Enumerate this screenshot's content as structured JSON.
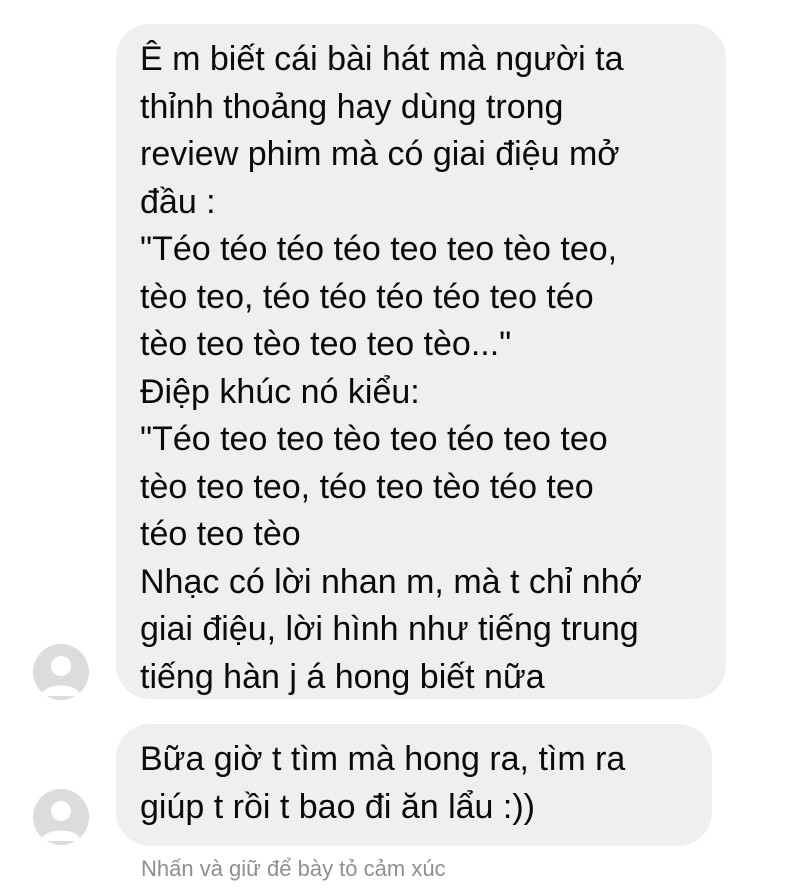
{
  "messages": [
    {
      "lines": [
        "Ê m biết cái bài hát mà người ta",
        "thỉnh thoảng hay dùng trong",
        "review phim mà có giai điệu mở",
        "đầu :",
        "\"Téo téo téo téo teo teo tèo teo,",
        "tèo teo, téo téo téo téo teo téo",
        "tèo teo tèo teo teo tèo...\"",
        "Điệp khúc nó kiểu:",
        "\"Téo teo teo tèo teo téo teo teo",
        "tèo teo teo, téo teo tèo téo teo",
        "téo teo tèo",
        "Nhạc có lời nhan m, mà t chỉ nhớ",
        "giai điệu, lời hình như tiếng trung",
        "tiếng hàn j á hong biết nữa"
      ]
    },
    {
      "lines": [
        "Bữa giờ t tìm mà hong ra, tìm ra",
        "giúp t rồi t bao đi ăn lẩu :))"
      ]
    }
  ],
  "reaction_hint": "Nhấn và giữ để bày tỏ cảm xúc",
  "avatar_icon": "person-avatar-icon",
  "colors": {
    "background": "#ffffff",
    "bubble": "#efeff1",
    "text": "#0a0a0a",
    "hint": "#8e8e93",
    "avatar_bg": "#dcdcdf",
    "avatar_fg": "#ffffff"
  }
}
